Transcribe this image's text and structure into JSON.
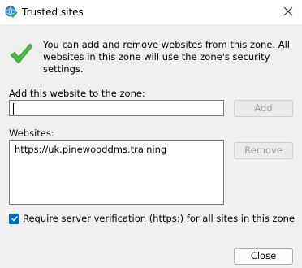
{
  "window": {
    "title": "Trusted sites",
    "title_icon": "globe-check-icon",
    "close_icon": "close-icon"
  },
  "info": {
    "icon": "green-check-icon",
    "text": "You can add and remove websites from this zone. All websites in this zone will use the zone's security settings."
  },
  "add": {
    "label": "Add this website to the zone:",
    "value": "",
    "button_label": "Add"
  },
  "websites": {
    "label": "Websites:",
    "items": [
      "https://uk.pinewooddms.training"
    ],
    "remove_label": "Remove"
  },
  "verification": {
    "checked": true,
    "label": "Require server verification (https:) for all sites in this zone"
  },
  "footer": {
    "close_label": "Close"
  },
  "colors": {
    "accent": "#0067c0",
    "check_green": "#4cb648"
  }
}
